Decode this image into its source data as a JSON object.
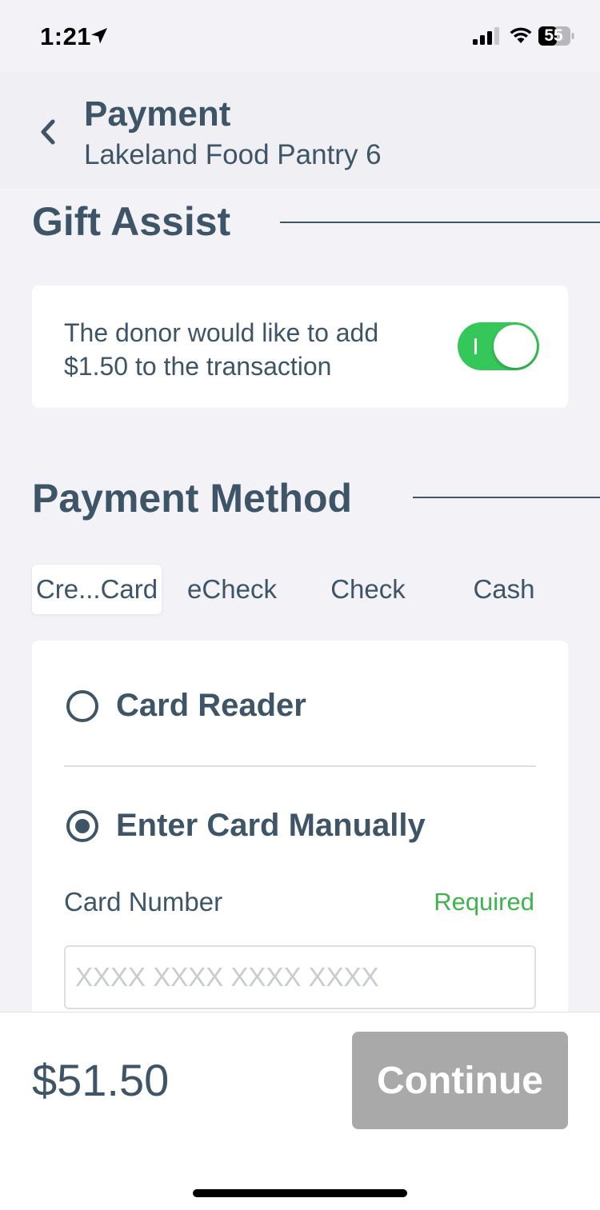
{
  "status_bar": {
    "time": "1:21",
    "battery_level": "55",
    "icons": [
      "location-arrow-icon",
      "cellular-signal-icon",
      "wifi-icon",
      "battery-icon"
    ]
  },
  "header": {
    "title": "Payment",
    "subtitle": "Lakeland Food Pantry 6",
    "back_icon": "chevron-left-icon"
  },
  "gift_assist": {
    "heading": "Gift Assist",
    "text": "The donor would like to add $1.50 to the transaction",
    "toggle_on": true
  },
  "payment_method": {
    "heading": "Payment Method",
    "tabs": [
      {
        "label": "Cre...Card",
        "active": true
      },
      {
        "label": "eCheck",
        "active": false
      },
      {
        "label": "Check",
        "active": false
      },
      {
        "label": "Cash",
        "active": false
      }
    ],
    "options": [
      {
        "label": "Card Reader",
        "selected": false
      },
      {
        "label": "Enter Card Manually",
        "selected": true
      }
    ],
    "card_number": {
      "label": "Card Number",
      "required_text": "Required",
      "placeholder": "XXXX XXXX XXXX XXXX",
      "value": ""
    }
  },
  "footer": {
    "total": "$51.50",
    "continue_label": "Continue"
  },
  "colors": {
    "text": "#3d5566",
    "toggle_on": "#35c759",
    "required": "#3fb34f",
    "button_disabled": "#a9a9a9",
    "background": "#f2f2f7"
  }
}
